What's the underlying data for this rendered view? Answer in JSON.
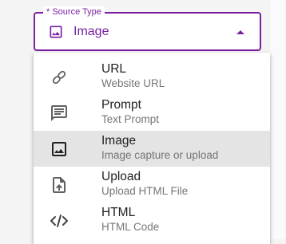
{
  "field": {
    "label": "* Source Type",
    "value": "Image",
    "icon": "image-icon",
    "accent_color": "#7b1fa2"
  },
  "menu": {
    "items": [
      {
        "title": "URL",
        "subtitle": "Website URL",
        "icon": "link-icon",
        "selected": false
      },
      {
        "title": "Prompt",
        "subtitle": "Text Prompt",
        "icon": "message-icon",
        "selected": false
      },
      {
        "title": "Image",
        "subtitle": "Image capture or upload",
        "icon": "image-icon",
        "selected": true
      },
      {
        "title": "Upload",
        "subtitle": "Upload HTML File",
        "icon": "file-upload-icon",
        "selected": false
      },
      {
        "title": "HTML",
        "subtitle": "HTML Code",
        "icon": "code-icon",
        "selected": false
      }
    ]
  }
}
